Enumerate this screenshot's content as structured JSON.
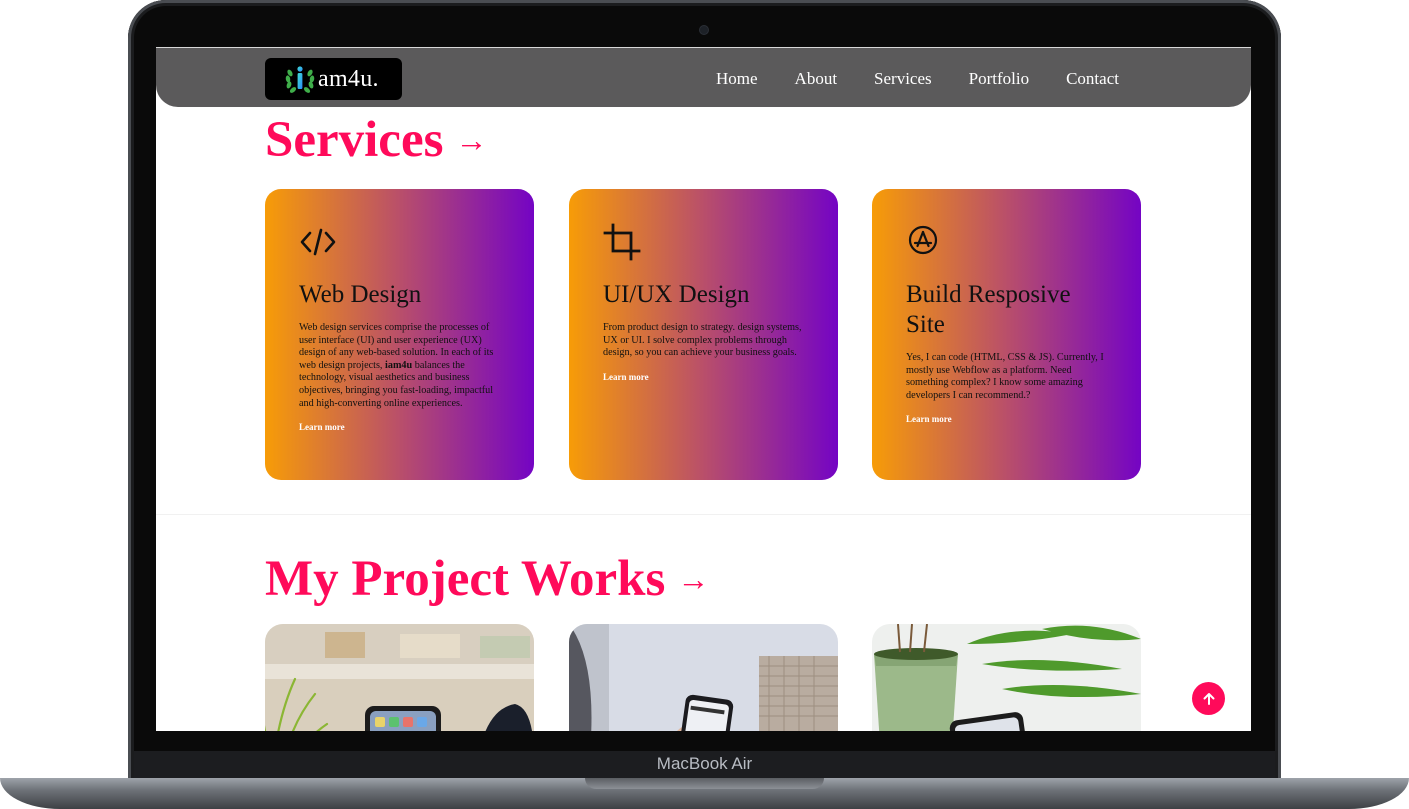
{
  "device": {
    "label": "MacBook Air"
  },
  "brand": {
    "logo_text": "am4u.",
    "accent": "#ff0a5a",
    "nav_bg": "#5b5a5b"
  },
  "nav": {
    "items": [
      {
        "label": "Home"
      },
      {
        "label": "About"
      },
      {
        "label": "Services"
      },
      {
        "label": "Portfolio"
      },
      {
        "label": "Contact"
      }
    ]
  },
  "services": {
    "title": "Services",
    "arrow": "→",
    "gradient": [
      "#f79c07",
      "#b94f6a",
      "#7404c4"
    ],
    "cards": [
      {
        "icon": "code-icon",
        "title": "Web Design",
        "desc_before": "Web design services comprise the processes of user interface (UI) and user experience (UX) design of any web-based solution. In each of its web design projects, ",
        "desc_bold": "iam4u",
        "desc_after": " balances the technology, visual aesthetics and business objectives, bringing you fast-loading, impactful and high-converting online experiences.",
        "link": "Learn more"
      },
      {
        "icon": "crop-icon",
        "title": "UI/UX Design",
        "desc": "From product design to strategy. design systems, UX or UI. I solve complex problems through design, so you can achieve your business goals.",
        "link": "Learn more"
      },
      {
        "icon": "app-store-icon",
        "title": "Build Resposive Site",
        "desc": "Yes, I can code (HTML, CSS & JS). Currently, I mostly use Webflow as a platform. Need something complex? I know some amazing developers I can recommend.?",
        "link": "Learn more"
      }
    ]
  },
  "projects": {
    "title": "My Project Works",
    "arrow": "→",
    "items": [
      {
        "image": "phone-on-desk-photo"
      },
      {
        "image": "hand-holding-phone-photo"
      },
      {
        "image": "plant-and-phone-photo"
      }
    ]
  },
  "scroll_top": {
    "icon": "arrow-up-icon"
  }
}
